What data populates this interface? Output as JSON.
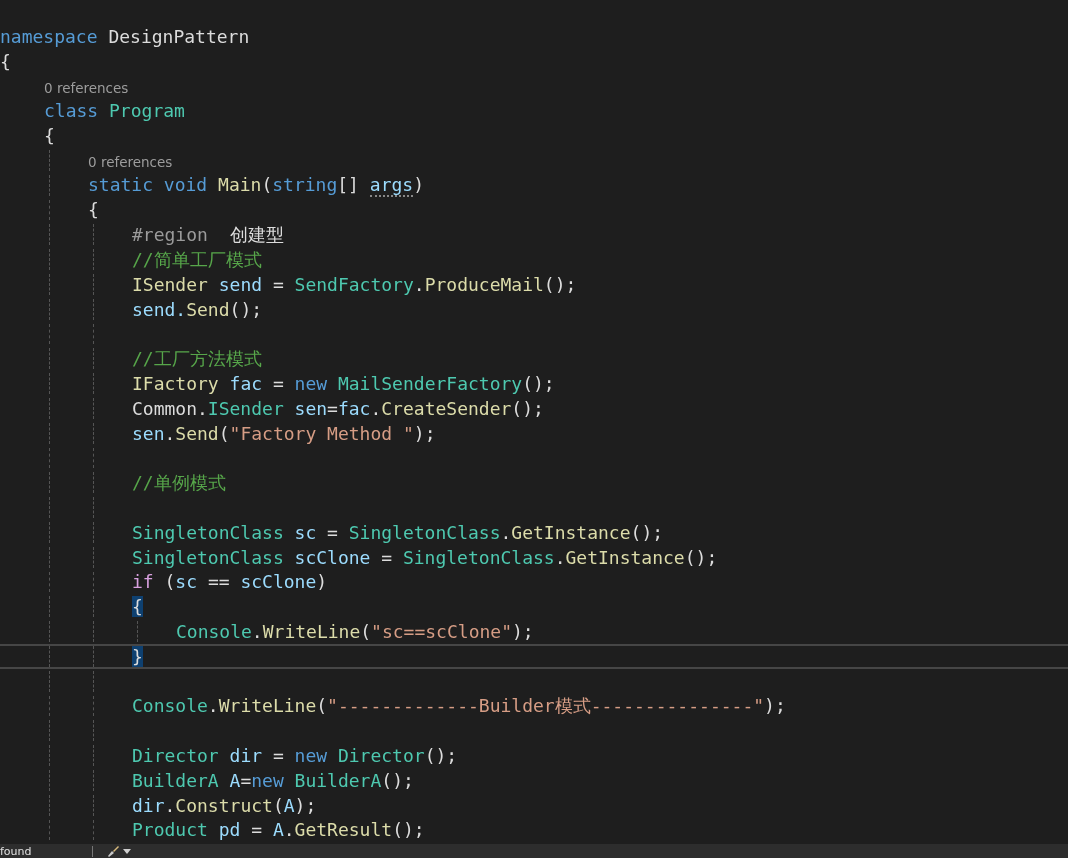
{
  "lines": [
    {
      "kind": "code",
      "tokens": [
        {
          "t": "namespace ",
          "color": "#569cd6"
        },
        {
          "t": "DesignPattern",
          "color": "#dcdcdc"
        }
      ]
    },
    {
      "kind": "code",
      "tokens": [
        {
          "t": "{",
          "color": "#dcdcdc"
        }
      ],
      "children": [
        {
          "kind": "lens",
          "text": "0 references"
        },
        {
          "kind": "code",
          "tokens": [
            {
              "t": "class ",
              "color": "#569cd6"
            },
            {
              "t": "Program",
              "color": "#4ec9b0"
            }
          ]
        },
        {
          "kind": "code",
          "tokens": [
            {
              "t": "{",
              "color": "#dcdcdc"
            }
          ],
          "children": [
            {
              "kind": "lens",
              "text": "0 references"
            },
            {
              "kind": "code",
              "tokens": [
                {
                  "t": "static void ",
                  "color": "#569cd6"
                },
                {
                  "t": "Main",
                  "color": "#dcdcaa"
                },
                {
                  "t": "(",
                  "color": "#dcdcdc"
                },
                {
                  "t": "string",
                  "color": "#569cd6"
                },
                {
                  "t": "[] ",
                  "color": "#dcdcdc"
                },
                {
                  "t": "args",
                  "color": "#9cdcfe",
                  "hint": true
                },
                {
                  "t": ")",
                  "color": "#dcdcdc"
                }
              ]
            },
            {
              "kind": "code",
              "tokens": [
                {
                  "t": "{",
                  "color": "#dcdcdc"
                }
              ],
              "children": [
                {
                  "kind": "code",
                  "tokens": [
                    {
                      "t": "#region",
                      "color": "#9b9b9b"
                    },
                    {
                      "t": "  创建型",
                      "color": "#dcdcdc"
                    }
                  ]
                },
                {
                  "kind": "code",
                  "tokens": [
                    {
                      "t": "//简单工厂模式",
                      "color": "#57a64a"
                    }
                  ]
                },
                {
                  "kind": "code",
                  "tokens": [
                    {
                      "t": "ISender ",
                      "color": "#dcdcaa"
                    },
                    {
                      "t": "send",
                      "color": "#9cdcfe"
                    },
                    {
                      "t": " = ",
                      "color": "#dcdcdc"
                    },
                    {
                      "t": "SendFactory",
                      "color": "#4ec9b0"
                    },
                    {
                      "t": ".",
                      "color": "#dcdcdc"
                    },
                    {
                      "t": "ProduceMail",
                      "color": "#dcdcaa"
                    },
                    {
                      "t": "();",
                      "color": "#dcdcdc"
                    }
                  ]
                },
                {
                  "kind": "code",
                  "tokens": [
                    {
                      "t": "send.",
                      "color": "#9cdcfe"
                    },
                    {
                      "t": "Send",
                      "color": "#dcdcaa"
                    },
                    {
                      "t": "();",
                      "color": "#dcdcdc"
                    }
                  ]
                },
                {
                  "kind": "blank"
                },
                {
                  "kind": "code",
                  "tokens": [
                    {
                      "t": "//工厂方法模式",
                      "color": "#57a64a"
                    }
                  ]
                },
                {
                  "kind": "code",
                  "tokens": [
                    {
                      "t": "IFactory ",
                      "color": "#dcdcaa"
                    },
                    {
                      "t": "fac",
                      "color": "#9cdcfe"
                    },
                    {
                      "t": " = ",
                      "color": "#dcdcdc"
                    },
                    {
                      "t": "new ",
                      "color": "#569cd6"
                    },
                    {
                      "t": "MailSenderFactory",
                      "color": "#4ec9b0"
                    },
                    {
                      "t": "();",
                      "color": "#dcdcdc"
                    }
                  ]
                },
                {
                  "kind": "code",
                  "tokens": [
                    {
                      "t": "Common.",
                      "color": "#dcdcdc"
                    },
                    {
                      "t": "ISender ",
                      "color": "#4ec9b0"
                    },
                    {
                      "t": "sen",
                      "color": "#9cdcfe"
                    },
                    {
                      "t": "=",
                      "color": "#dcdcdc"
                    },
                    {
                      "t": "fac",
                      "color": "#9cdcfe"
                    },
                    {
                      "t": ".",
                      "color": "#dcdcdc"
                    },
                    {
                      "t": "CreateSender",
                      "color": "#dcdcaa"
                    },
                    {
                      "t": "();",
                      "color": "#dcdcdc"
                    }
                  ]
                },
                {
                  "kind": "code",
                  "tokens": [
                    {
                      "t": "sen",
                      "color": "#9cdcfe"
                    },
                    {
                      "t": ".",
                      "color": "#dcdcdc"
                    },
                    {
                      "t": "Send",
                      "color": "#dcdcaa"
                    },
                    {
                      "t": "(",
                      "color": "#dcdcdc"
                    },
                    {
                      "t": "\"Factory Method \"",
                      "color": "#d69d85"
                    },
                    {
                      "t": ");",
                      "color": "#dcdcdc"
                    }
                  ]
                },
                {
                  "kind": "blank"
                },
                {
                  "kind": "code",
                  "tokens": [
                    {
                      "t": "//单例模式",
                      "color": "#57a64a"
                    }
                  ]
                },
                {
                  "kind": "blank"
                },
                {
                  "kind": "code",
                  "tokens": [
                    {
                      "t": "SingletonClass ",
                      "color": "#4ec9b0"
                    },
                    {
                      "t": "sc",
                      "color": "#9cdcfe"
                    },
                    {
                      "t": " = ",
                      "color": "#dcdcdc"
                    },
                    {
                      "t": "SingletonClass",
                      "color": "#4ec9b0"
                    },
                    {
                      "t": ".",
                      "color": "#dcdcdc"
                    },
                    {
                      "t": "GetInstance",
                      "color": "#dcdcaa"
                    },
                    {
                      "t": "();",
                      "color": "#dcdcdc"
                    }
                  ]
                },
                {
                  "kind": "code",
                  "tokens": [
                    {
                      "t": "SingletonClass ",
                      "color": "#4ec9b0"
                    },
                    {
                      "t": "scClone",
                      "color": "#9cdcfe"
                    },
                    {
                      "t": " = ",
                      "color": "#dcdcdc"
                    },
                    {
                      "t": "SingletonClass",
                      "color": "#4ec9b0"
                    },
                    {
                      "t": ".",
                      "color": "#dcdcdc"
                    },
                    {
                      "t": "GetInstance",
                      "color": "#dcdcaa"
                    },
                    {
                      "t": "();",
                      "color": "#dcdcdc"
                    }
                  ]
                },
                {
                  "kind": "code",
                  "tokens": [
                    {
                      "t": "if ",
                      "color": "#d8a0df"
                    },
                    {
                      "t": "(",
                      "color": "#dcdcdc"
                    },
                    {
                      "t": "sc",
                      "color": "#9cdcfe"
                    },
                    {
                      "t": " == ",
                      "color": "#dcdcdc"
                    },
                    {
                      "t": "scClone",
                      "color": "#9cdcfe"
                    },
                    {
                      "t": ")",
                      "color": "#dcdcdc"
                    }
                  ]
                },
                {
                  "kind": "code",
                  "tokens": [
                    {
                      "t": "{",
                      "highlight": true
                    }
                  ],
                  "children": [
                    {
                      "kind": "code",
                      "tokens": [
                        {
                          "t": "Console",
                          "color": "#4ec9b0"
                        },
                        {
                          "t": ".",
                          "color": "#dcdcdc"
                        },
                        {
                          "t": "WriteLine",
                          "color": "#dcdcaa"
                        },
                        {
                          "t": "(",
                          "color": "#dcdcdc"
                        },
                        {
                          "t": "\"sc==scClone\"",
                          "color": "#d69d85"
                        },
                        {
                          "t": ");",
                          "color": "#dcdcdc"
                        }
                      ]
                    }
                  ]
                },
                {
                  "kind": "code",
                  "current": true,
                  "tokens": [
                    {
                      "t": "}",
                      "highlight": true
                    }
                  ]
                },
                {
                  "kind": "blank"
                },
                {
                  "kind": "code",
                  "tokens": [
                    {
                      "t": "Console",
                      "color": "#4ec9b0"
                    },
                    {
                      "t": ".",
                      "color": "#dcdcdc"
                    },
                    {
                      "t": "WriteLine",
                      "color": "#dcdcaa"
                    },
                    {
                      "t": "(",
                      "color": "#dcdcdc"
                    },
                    {
                      "t": "\"-------------Builder模式---------------\"",
                      "color": "#d69d85"
                    },
                    {
                      "t": ");",
                      "color": "#dcdcdc"
                    }
                  ]
                },
                {
                  "kind": "blank"
                },
                {
                  "kind": "code",
                  "tokens": [
                    {
                      "t": "Director ",
                      "color": "#4ec9b0"
                    },
                    {
                      "t": "dir",
                      "color": "#9cdcfe"
                    },
                    {
                      "t": " = ",
                      "color": "#dcdcdc"
                    },
                    {
                      "t": "new ",
                      "color": "#569cd6"
                    },
                    {
                      "t": "Director",
                      "color": "#4ec9b0"
                    },
                    {
                      "t": "();",
                      "color": "#dcdcdc"
                    }
                  ]
                },
                {
                  "kind": "code",
                  "tokens": [
                    {
                      "t": "BuilderA ",
                      "color": "#4ec9b0"
                    },
                    {
                      "t": "A",
                      "color": "#9cdcfe"
                    },
                    {
                      "t": "=",
                      "color": "#dcdcdc"
                    },
                    {
                      "t": "new ",
                      "color": "#569cd6"
                    },
                    {
                      "t": "BuilderA",
                      "color": "#4ec9b0"
                    },
                    {
                      "t": "();",
                      "color": "#dcdcdc"
                    }
                  ]
                },
                {
                  "kind": "code",
                  "tokens": [
                    {
                      "t": "dir",
                      "color": "#9cdcfe"
                    },
                    {
                      "t": ".",
                      "color": "#dcdcdc"
                    },
                    {
                      "t": "Construct",
                      "color": "#dcdcaa"
                    },
                    {
                      "t": "(",
                      "color": "#dcdcdc"
                    },
                    {
                      "t": "A",
                      "color": "#9cdcfe"
                    },
                    {
                      "t": ");",
                      "color": "#dcdcdc"
                    }
                  ]
                },
                {
                  "kind": "code",
                  "tokens": [
                    {
                      "t": "Product ",
                      "color": "#4ec9b0"
                    },
                    {
                      "t": "pd",
                      "color": "#9cdcfe"
                    },
                    {
                      "t": " = ",
                      "color": "#dcdcdc"
                    },
                    {
                      "t": "A",
                      "color": "#9cdcfe"
                    },
                    {
                      "t": ".",
                      "color": "#dcdcdc"
                    },
                    {
                      "t": "GetResult",
                      "color": "#dcdcaa"
                    },
                    {
                      "t": "();",
                      "color": "#dcdcdc"
                    }
                  ]
                }
              ]
            }
          ]
        }
      ]
    }
  ],
  "status_bar": {
    "text": "found"
  }
}
